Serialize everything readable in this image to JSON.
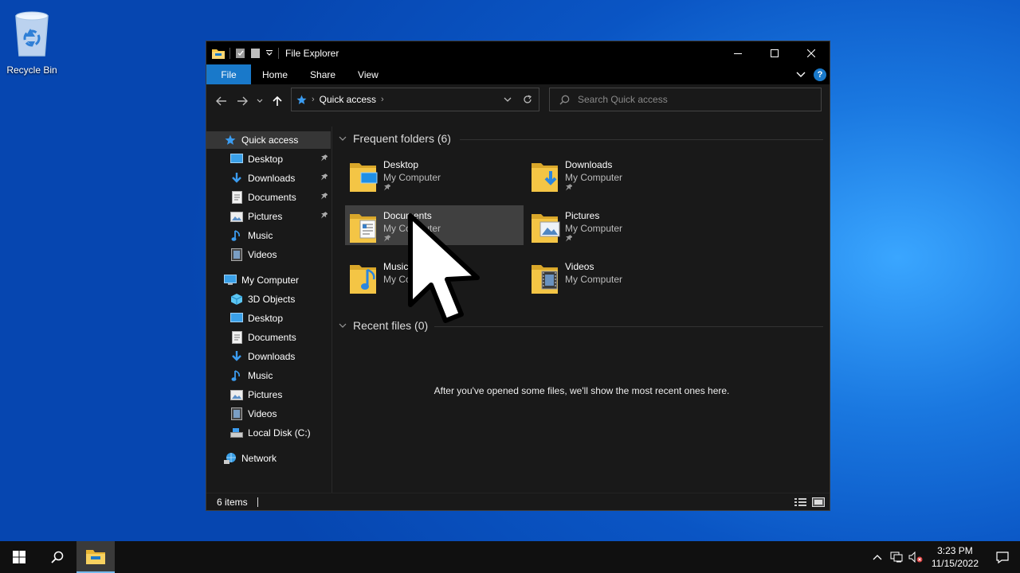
{
  "desktop": {
    "recycle_bin_label": "Recycle Bin"
  },
  "window": {
    "title": "File Explorer",
    "ribbon_tabs": [
      "File",
      "Home",
      "Share",
      "View"
    ],
    "address": {
      "crumb": "Quick access"
    },
    "search": {
      "placeholder": "Search Quick access"
    },
    "nav": {
      "quick_access": "Quick access",
      "quick_items": [
        {
          "label": "Desktop",
          "icon": "desktop-icon",
          "pinned": true
        },
        {
          "label": "Downloads",
          "icon": "downloads-icon",
          "pinned": true
        },
        {
          "label": "Documents",
          "icon": "documents-icon",
          "pinned": true
        },
        {
          "label": "Pictures",
          "icon": "pictures-icon",
          "pinned": true
        },
        {
          "label": "Music",
          "icon": "music-icon",
          "pinned": false
        },
        {
          "label": "Videos",
          "icon": "videos-icon",
          "pinned": false
        }
      ],
      "my_computer": "My Computer",
      "computer_items": [
        {
          "label": "3D Objects",
          "icon": "3d-objects-icon"
        },
        {
          "label": "Desktop",
          "icon": "desktop-icon"
        },
        {
          "label": "Documents",
          "icon": "documents-icon"
        },
        {
          "label": "Downloads",
          "icon": "downloads-icon"
        },
        {
          "label": "Music",
          "icon": "music-icon"
        },
        {
          "label": "Pictures",
          "icon": "pictures-icon"
        },
        {
          "label": "Videos",
          "icon": "videos-icon"
        },
        {
          "label": "Local Disk (C:)",
          "icon": "local-disk-icon"
        }
      ],
      "network": "Network"
    },
    "frequent": {
      "heading": "Frequent folders (6)",
      "folders": [
        {
          "name": "Desktop",
          "location": "My Computer",
          "pinned": true
        },
        {
          "name": "Downloads",
          "location": "My Computer",
          "pinned": true
        },
        {
          "name": "Documents",
          "location": "My Computer",
          "pinned": true
        },
        {
          "name": "Pictures",
          "location": "My Computer",
          "pinned": true
        },
        {
          "name": "Music",
          "location": "My Computer",
          "pinned": false
        },
        {
          "name": "Videos",
          "location": "My Computer",
          "pinned": false
        }
      ]
    },
    "recent": {
      "heading": "Recent files (0)",
      "empty_message": "After you've opened some files, we'll show the most recent ones here."
    },
    "status": {
      "item_count": "6 items"
    }
  },
  "taskbar": {
    "time": "3:23 PM",
    "date": "11/15/2022"
  },
  "colors": {
    "accent": "#1979ca",
    "window_bg": "#191919",
    "folder_yellow": "#f4c545"
  }
}
